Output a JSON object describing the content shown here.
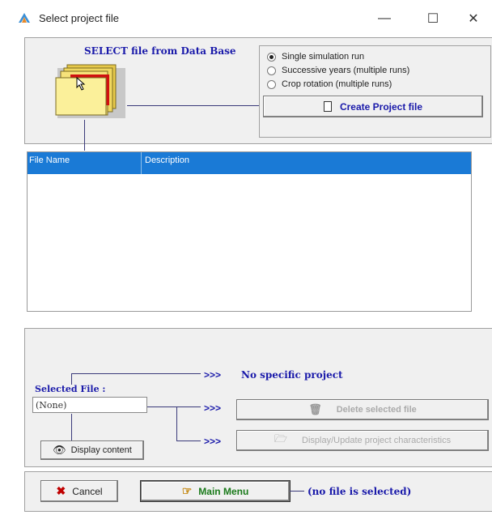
{
  "window": {
    "title": "Select project file",
    "minimize": "—",
    "maximize": "☐",
    "close": "✕"
  },
  "database": {
    "heading": "SELECT file from Data Base"
  },
  "run_options": {
    "options": [
      {
        "label": "Single simulation run",
        "selected": true
      },
      {
        "label": "Successive years (multiple runs)",
        "selected": false
      },
      {
        "label": "Crop rotation (multiple runs)",
        "selected": false
      }
    ],
    "create_button": "Create Project file"
  },
  "file_table": {
    "columns": [
      "File Name",
      "Description"
    ],
    "rows": []
  },
  "selection": {
    "label": "Selected File :",
    "value": "(None)",
    "arrows": ">>>",
    "no_project": "No specific project",
    "delete_button": "Delete selected file",
    "update_button": "Display/Update project characteristics",
    "display_button": "Display content"
  },
  "footer": {
    "cancel_button": "Cancel",
    "main_menu_button": "Main Menu",
    "status": "(no file is selected)"
  },
  "colors": {
    "accent_blue": "#1a1aaa",
    "table_header": "#1a7ad6",
    "main_menu_green": "#1a7a1a",
    "cancel_red": "#c00000"
  }
}
